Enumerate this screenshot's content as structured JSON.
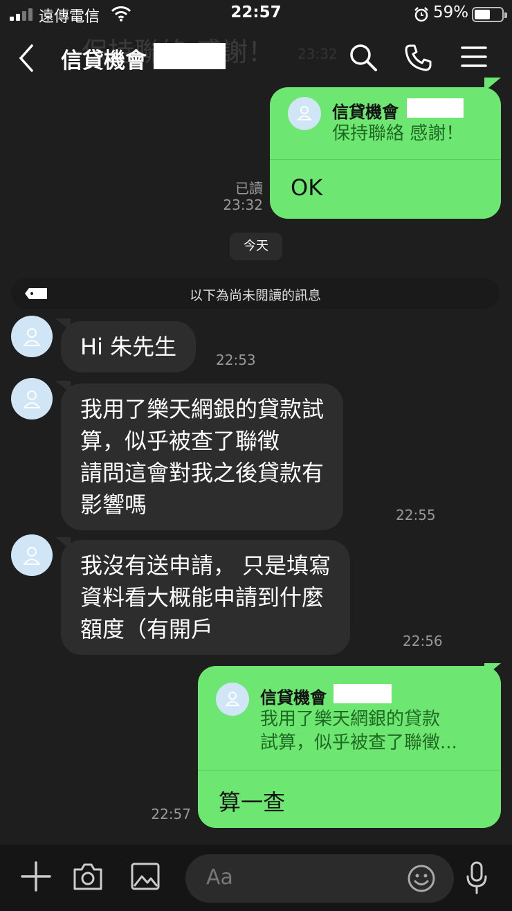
{
  "status_bar": {
    "carrier": "遠傳電信",
    "time": "22:57",
    "battery_percent": "59%",
    "battery_level": 0.59
  },
  "header": {
    "title": "信貸機會",
    "ghost_text": "保持聯絡 感謝！",
    "ghost_time": "23:32"
  },
  "messages": {
    "m1": {
      "quote_name": "信貸機會",
      "quote_text": "保持聯絡 感謝！",
      "reply": "OK",
      "read_label": "已讀",
      "time": "23:32"
    },
    "date_divider": "今天",
    "unread_divider": "以下為尚未閱讀的訊息",
    "m2": {
      "text": "Hi 朱先生",
      "time": "22:53"
    },
    "m3": {
      "text": "我用了樂天網銀的貸款試\n算，似乎被查了聯徵\n請問這會對我之後貸款有\n影響嗎",
      "time": "22:55"
    },
    "m4": {
      "text": "我沒有送申請， 只是填寫\n資料看大概能申請到什麼\n額度（有開戶",
      "time": "22:56"
    },
    "m5": {
      "quote_name": "信貸機會",
      "quote_text": "我用了樂天網銀的貸款\n試算，似乎被查了聯徵...",
      "reply": "算一查",
      "time": "22:57"
    }
  },
  "input": {
    "placeholder": "Aa"
  },
  "colors": {
    "background": "#1e1e1e",
    "incoming_bubble": "#2d2d2d",
    "outgoing_bubble": "#6ee772",
    "avatar_bg": "#d0e6f6"
  },
  "icons": [
    "back-icon",
    "search-icon",
    "phone-icon",
    "menu-icon",
    "tag-icon",
    "plus-icon",
    "camera-icon",
    "image-icon",
    "emoji-icon",
    "mic-icon",
    "wifi-icon",
    "alarm-icon",
    "user-icon"
  ]
}
